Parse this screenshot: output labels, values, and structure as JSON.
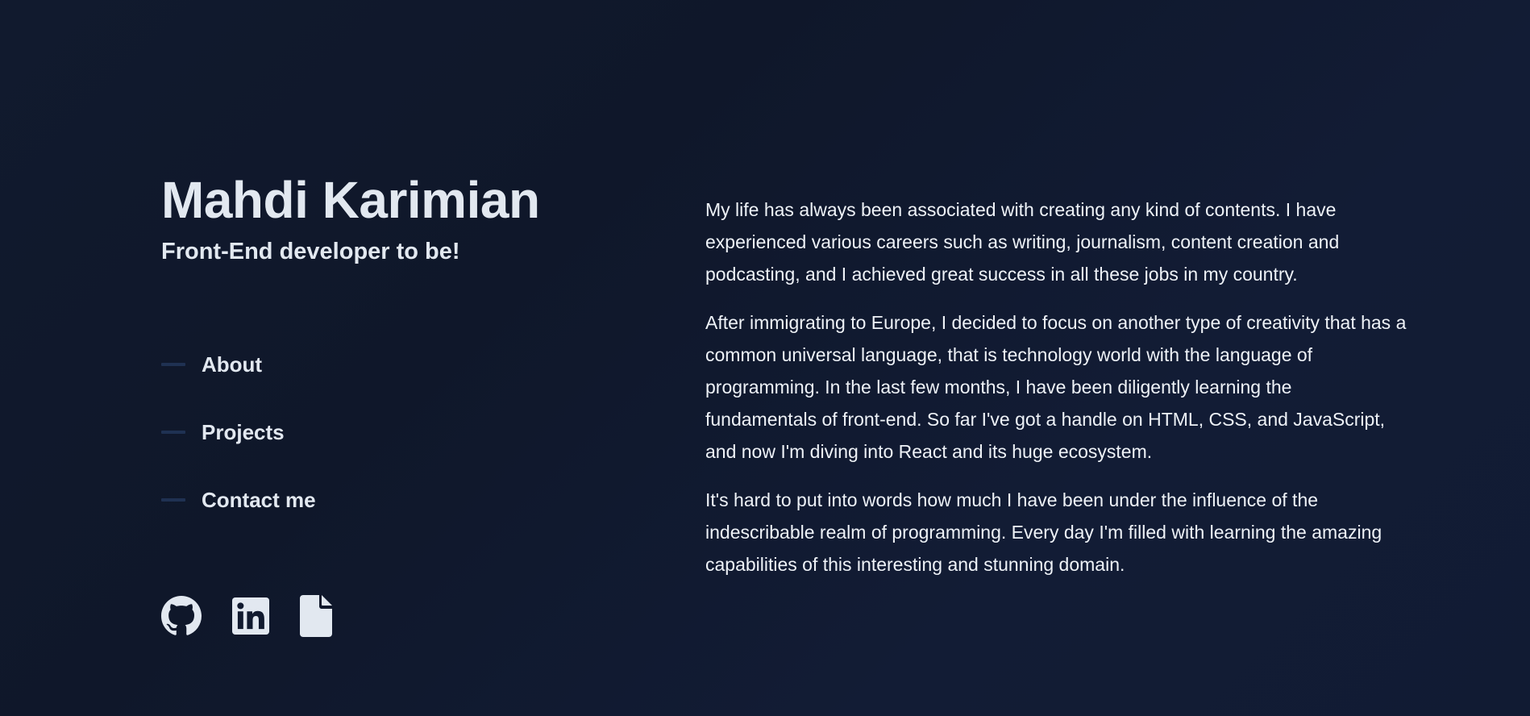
{
  "header": {
    "name": "Mahdi Karimian",
    "tagline": "Front-End developer to be!"
  },
  "nav": {
    "items": [
      {
        "label": "About"
      },
      {
        "label": "Projects"
      },
      {
        "label": "Contact me"
      }
    ]
  },
  "socials": [
    {
      "icon": "github-icon"
    },
    {
      "icon": "linkedin-icon"
    },
    {
      "icon": "document-icon"
    }
  ],
  "about": {
    "paragraphs": [
      "My life has always been associated with creating any kind of contents. I have experienced various careers such as writing, journalism, content creation and podcasting, and I achieved great success in all these jobs in my country.",
      "After immigrating to Europe, I decided to focus on another type of creativity that has a common universal language, that is technology world with the language of programming. In the last few months, I have been diligently learning the fundamentals of front-end. So far I've got a handle on HTML, CSS, and JavaScript, and now I'm diving into React and its huge ecosystem.",
      "It's hard to put into words how much I have been under the influence of the indescribable realm of programming. Every day I'm filled with learning the amazing capabilities of this interesting and stunning domain."
    ]
  },
  "colors": {
    "background": "#0f172a",
    "text": "#e2e8f0",
    "nav_line": "#1f3152"
  }
}
